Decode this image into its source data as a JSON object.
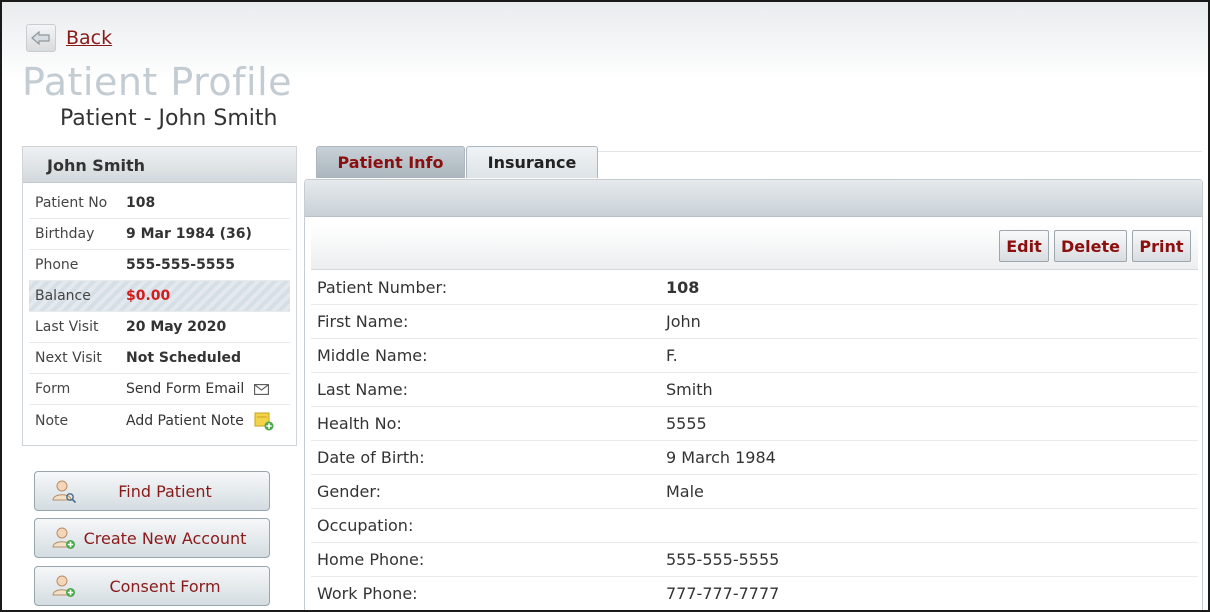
{
  "header": {
    "back_label": "Back",
    "page_title": "Patient Profile",
    "subtitle": "Patient - John Smith"
  },
  "profile_card": {
    "name": "John Smith",
    "rows": [
      {
        "label": "Patient No",
        "value": "108"
      },
      {
        "label": "Birthday",
        "value": "9 Mar 1984 (36)"
      },
      {
        "label": "Phone",
        "value": "555-555-5555"
      },
      {
        "label": "Balance",
        "value": "$0.00"
      },
      {
        "label": "Last Visit",
        "value": "20 May 2020"
      },
      {
        "label": "Next Visit",
        "value": "Not Scheduled"
      },
      {
        "label": "Form",
        "value": "Send Form Email",
        "icon": "envelope-icon"
      },
      {
        "label": "Note",
        "value": "Add Patient Note",
        "icon": "add-note-icon"
      }
    ]
  },
  "side_buttons": [
    {
      "label": "Find Patient",
      "icon": "find-patient-icon"
    },
    {
      "label": "Create New Account",
      "icon": "add-patient-icon"
    },
    {
      "label": "Consent Form",
      "icon": "consent-form-icon"
    }
  ],
  "tabs": [
    {
      "label": "Patient Info",
      "active": true
    },
    {
      "label": "Insurance",
      "active": false
    }
  ],
  "toolbar": {
    "edit_label": "Edit",
    "delete_label": "Delete",
    "print_label": "Print"
  },
  "patient_info": [
    {
      "label": "Patient Number:",
      "value": "108"
    },
    {
      "label": "First Name:",
      "value": "John"
    },
    {
      "label": "Middle Name:",
      "value": "F."
    },
    {
      "label": "Last Name:",
      "value": "Smith"
    },
    {
      "label": "Health No:",
      "value": "5555"
    },
    {
      "label": "Date of Birth:",
      "value": "9 March 1984"
    },
    {
      "label": "Gender:",
      "value": "Male"
    },
    {
      "label": "Occupation:",
      "value": ""
    },
    {
      "label": "Home Phone:",
      "value": "555-555-5555"
    },
    {
      "label": "Work Phone:",
      "value": "777-777-7777"
    }
  ],
  "colors": {
    "accent_red": "#8b0f0f",
    "balance_red": "#d41a1a",
    "title_gray": "#c3ccd3"
  }
}
